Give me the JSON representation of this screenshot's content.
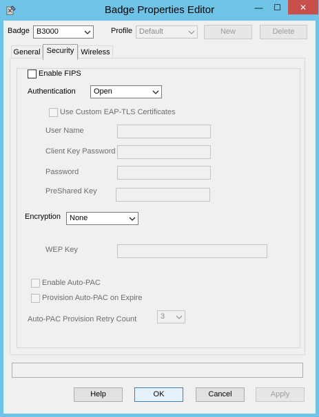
{
  "window": {
    "title": "Badge Properties Editor",
    "min_glyph": "—",
    "max_glyph": "☐",
    "close_glyph": "✕"
  },
  "topbar": {
    "badge_label": "Badge",
    "badge_value": "B3000",
    "profile_label": "Profile",
    "profile_value": "Default",
    "new_label": "New",
    "delete_label": "Delete"
  },
  "tabs": [
    {
      "label": "General"
    },
    {
      "label": "Security"
    },
    {
      "label": "Wireless"
    }
  ],
  "security": {
    "enable_fips_label": "Enable FIPS",
    "authentication_label": "Authentication",
    "authentication_value": "Open",
    "use_custom_eap_label": "Use Custom EAP-TLS Certificates",
    "user_name_label": "User Name",
    "client_key_password_label": "Client Key Password",
    "password_label": "Password",
    "preshared_key_label": "PreShared Key",
    "encryption_label": "Encryption",
    "encryption_value": "None",
    "wep_key_label": "WEP Key",
    "enable_auto_pac_label": "Enable Auto-PAC",
    "provision_auto_pac_label": "Provision Auto-PAC on Expire",
    "retry_count_label": "Auto-PAC Provision Retry Count",
    "retry_count_value": "3"
  },
  "buttons": {
    "help": "Help",
    "ok": "OK",
    "cancel": "Cancel",
    "apply": "Apply"
  }
}
